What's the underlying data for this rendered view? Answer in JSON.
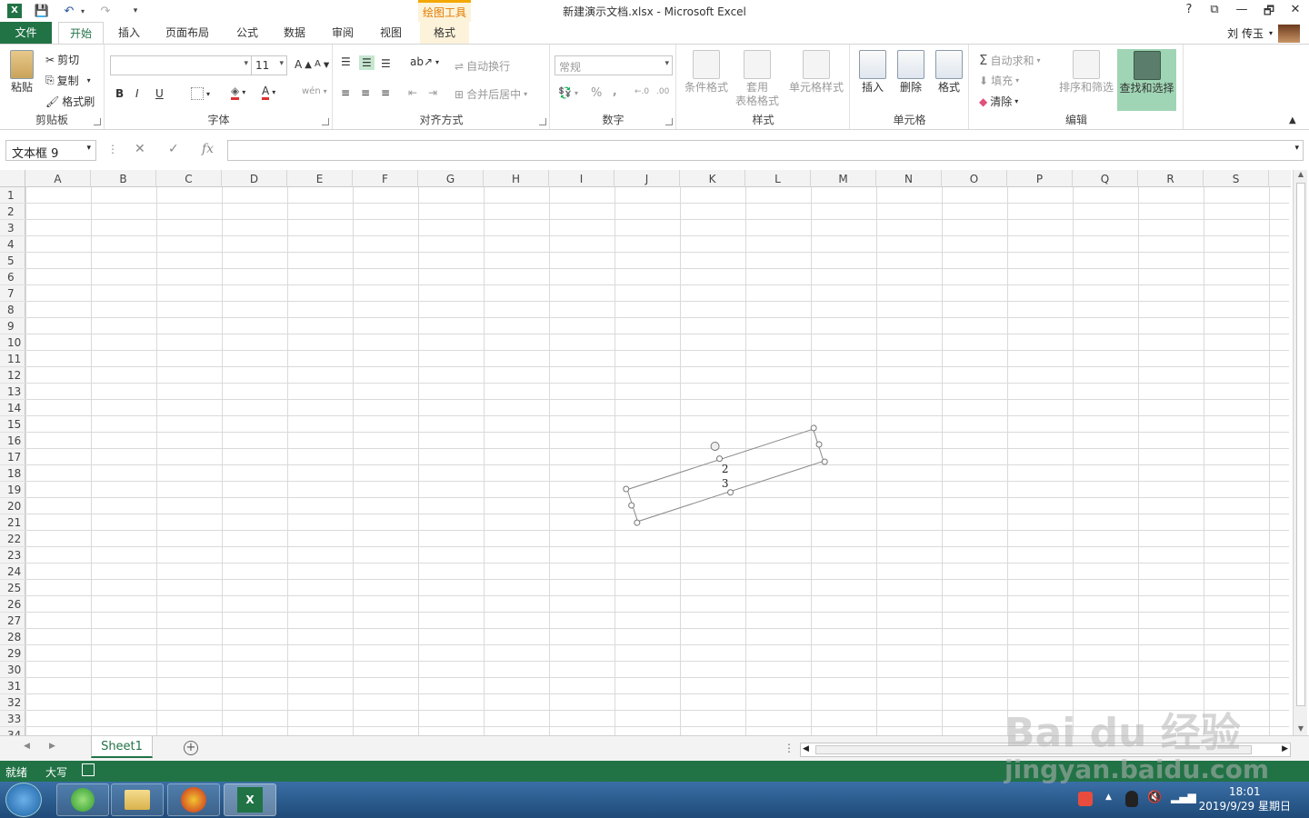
{
  "window": {
    "title": "新建演示文档.xlsx - Microsoft Excel",
    "contextual_group": "绘图工具",
    "contextual_tab": "格式",
    "help": "?",
    "minimize": "—",
    "restore": "🗗",
    "close": "✕"
  },
  "quick_access": {
    "save": "💾",
    "undo": "↶",
    "redo": "↷",
    "more": "▾"
  },
  "tabs": {
    "file": "文件",
    "home": "开始",
    "insert": "插入",
    "page_layout": "页面布局",
    "formulas": "公式",
    "data": "数据",
    "review": "审阅",
    "view": "视图"
  },
  "user": {
    "name": "刘 传玉"
  },
  "ribbon": {
    "clipboard": {
      "label": "剪贴板",
      "paste": "粘贴",
      "cut": "剪切",
      "copy": "复制",
      "format_painter": "格式刷"
    },
    "font": {
      "label": "字体",
      "name": "",
      "size": "11",
      "bold": "B",
      "italic": "I",
      "underline": "U"
    },
    "alignment": {
      "label": "对齐方式",
      "wrap": "自动换行",
      "merge": "合并后居中"
    },
    "number": {
      "label": "数字",
      "format": "常规",
      "percent": "%",
      "comma": ","
    },
    "styles": {
      "label": "样式",
      "conditional": "条件格式",
      "table1": "套用",
      "table2": "表格格式",
      "cell_styles": "单元格样式"
    },
    "cells": {
      "label": "单元格",
      "insert": "插入",
      "delete": "删除",
      "format": "格式"
    },
    "editing": {
      "label": "编辑",
      "autosum": "自动求和",
      "fill": "填充",
      "clear": "清除",
      "sort": "排序和筛选",
      "find": "查找和选择"
    }
  },
  "formula_bar": {
    "name_box": "文本框 9",
    "cancel": "✕",
    "enter": "✓",
    "fx": "fx",
    "value": ""
  },
  "columns": [
    "A",
    "B",
    "C",
    "D",
    "E",
    "F",
    "G",
    "H",
    "I",
    "J",
    "K",
    "L",
    "M",
    "N",
    "O",
    "P",
    "Q",
    "R",
    "S"
  ],
  "rows": [
    "1",
    "2",
    "3",
    "4",
    "5",
    "6",
    "7",
    "8",
    "9",
    "10",
    "11",
    "12",
    "13",
    "14",
    "15",
    "16",
    "17",
    "18",
    "19",
    "20",
    "21",
    "22",
    "23",
    "24",
    "25",
    "26",
    "27",
    "28",
    "29",
    "30",
    "31",
    "32",
    "33",
    "34"
  ],
  "textbox": {
    "line1": "2",
    "line2": "3"
  },
  "sheets": {
    "active": "Sheet1",
    "add": "+"
  },
  "status": {
    "ready": "就绪",
    "caps": "大写"
  },
  "taskbar": {
    "time": "18:01",
    "date": "2019/9/29 星期日"
  },
  "watermark": {
    "brand": "Bai du 经验",
    "url": "jingyan.baidu.com"
  }
}
